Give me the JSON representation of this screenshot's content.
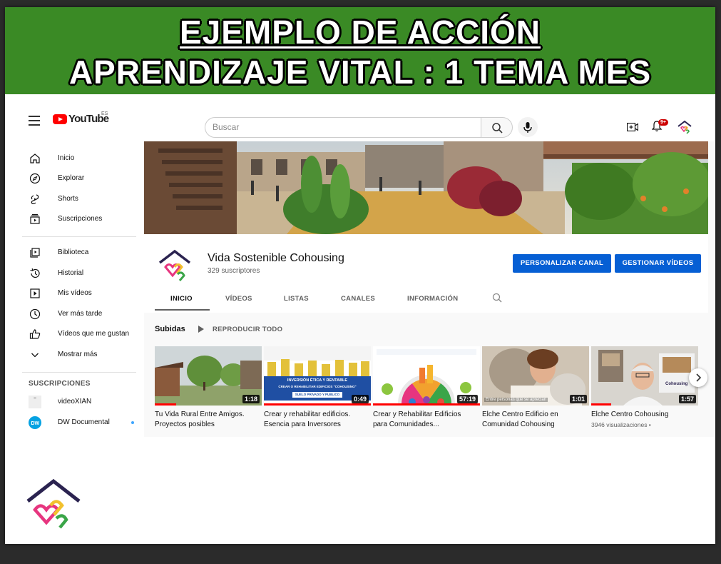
{
  "banner": {
    "line1": "EJEMPLO DE ACCIÓN",
    "line2": "APRENDIZAJE VITAL : 1 TEMA MES",
    "bg_color": "#3a8a25"
  },
  "topbar": {
    "logo_text": "YouTube",
    "logo_region": "ES",
    "search_placeholder": "Buscar",
    "notification_count": "9+"
  },
  "sidebar": {
    "main_items": [
      {
        "label": "Inicio",
        "icon": "home-icon"
      },
      {
        "label": "Explorar",
        "icon": "compass-icon"
      },
      {
        "label": "Shorts",
        "icon": "shorts-icon"
      },
      {
        "label": "Suscripciones",
        "icon": "subscriptions-icon"
      }
    ],
    "library_items": [
      {
        "label": "Biblioteca",
        "icon": "library-icon"
      },
      {
        "label": "Historial",
        "icon": "history-icon"
      },
      {
        "label": "Mis vídeos",
        "icon": "my-videos-icon"
      },
      {
        "label": "Ver más tarde",
        "icon": "clock-icon"
      },
      {
        "label": "Vídeos que me gustan",
        "icon": "thumbs-up-icon"
      },
      {
        "label": "Mostrar más",
        "icon": "chevron-down-icon"
      }
    ],
    "subscriptions_title": "SUSCRIPCIONES",
    "subscriptions": [
      {
        "label": "videoXIAN"
      },
      {
        "label": "DW Documental"
      }
    ]
  },
  "channel": {
    "name": "Vida Sostenible Cohousing",
    "subscribers": "329 suscriptores",
    "customize_label": "PERSONALIZAR CANAL",
    "manage_label": "GESTIONAR VÍDEOS",
    "tabs": [
      "INICIO",
      "VÍDEOS",
      "LISTAS",
      "CANALES",
      "INFORMACIÓN"
    ]
  },
  "uploads": {
    "title": "Subidas",
    "play_all": "REPRODUCIR TODO",
    "videos": [
      {
        "title_line1": "Tu Vida Rural Entre Amigos.",
        "title_line2": "Proyectos posibles",
        "duration": "1:18",
        "meta": ""
      },
      {
        "title_line1": "Crear y rehabilitar edificios.",
        "title_line2": "Esencia para Inversores",
        "duration": "0:49",
        "meta": "",
        "thumb_text1": "INVERSIÓN ÉTICA Y RENTABLE",
        "thumb_text2": "CREAR O REHABILITAR EDIFICIOS \"COHOUSING\"",
        "thumb_text3": "SUELO PRIVADO Y PUBLICO"
      },
      {
        "title_line1": "Crear y Rehabilitar Edificios",
        "title_line2": "para Comunidades...",
        "duration": "57:19",
        "meta": ""
      },
      {
        "title_line1": "Elche Centro Edificio en",
        "title_line2": "Comunidad Cohousing",
        "duration": "1:01",
        "meta": "",
        "thumb_caption": "Entre personas que se aprecian"
      },
      {
        "title_line1": "Elche Centro Cohousing",
        "title_line2": "",
        "duration": "1:57",
        "meta": "3946 visualizaciones •",
        "thumb_text1": "Cohousing"
      }
    ]
  }
}
